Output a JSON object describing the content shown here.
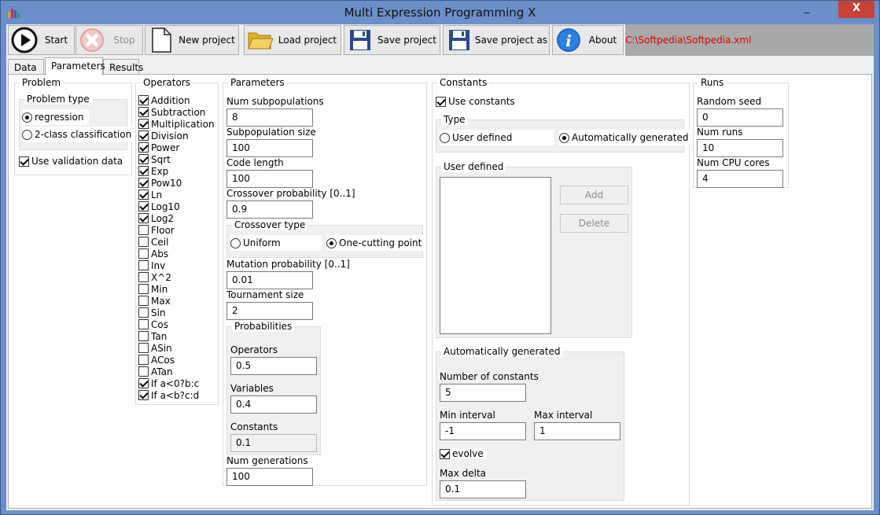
{
  "window": {
    "title": "Multi Expression Programming X",
    "minimize": "_",
    "close": "X"
  },
  "toolbar": {
    "start": "Start",
    "stop": "Stop",
    "new_project": "New project",
    "load_project": "Load project",
    "save_project": "Save project",
    "save_project_as": "Save project as",
    "about": "About",
    "path": "C:\\Softpedia\\Softpedia.xml"
  },
  "tabs": [
    "Data",
    "Parameters",
    "Results"
  ],
  "problem": {
    "title": "Problem",
    "type_title": "Problem type",
    "regression": "regression",
    "classification": "2-class classification",
    "use_validation": "Use validation data"
  },
  "operators": {
    "title": "Operators",
    "items": [
      {
        "label": "Addition",
        "checked": true
      },
      {
        "label": "Subtraction",
        "checked": true
      },
      {
        "label": "Multiplication",
        "checked": true
      },
      {
        "label": "Division",
        "checked": true
      },
      {
        "label": "Power",
        "checked": true
      },
      {
        "label": "Sqrt",
        "checked": true
      },
      {
        "label": "Exp",
        "checked": true
      },
      {
        "label": "Pow10",
        "checked": true
      },
      {
        "label": "Ln",
        "checked": true
      },
      {
        "label": "Log10",
        "checked": true
      },
      {
        "label": "Log2",
        "checked": true
      },
      {
        "label": "Floor",
        "checked": false
      },
      {
        "label": "Ceil",
        "checked": false
      },
      {
        "label": "Abs",
        "checked": false
      },
      {
        "label": "Inv",
        "checked": false
      },
      {
        "label": "X^2",
        "checked": false
      },
      {
        "label": "Min",
        "checked": false
      },
      {
        "label": "Max",
        "checked": false
      },
      {
        "label": "Sin",
        "checked": false
      },
      {
        "label": "Cos",
        "checked": false
      },
      {
        "label": "Tan",
        "checked": false
      },
      {
        "label": "ASin",
        "checked": false
      },
      {
        "label": "ACos",
        "checked": false
      },
      {
        "label": "ATan",
        "checked": false
      },
      {
        "label": "If a<0?b:c",
        "checked": true
      },
      {
        "label": "If a<b?c:d",
        "checked": true
      }
    ]
  },
  "parameters": {
    "title": "Parameters",
    "num_subpop_label": "Num subpopulations",
    "num_subpop": "8",
    "subpop_size_label": "Subpopulation size",
    "subpop_size": "100",
    "code_length_label": "Code length",
    "code_length": "100",
    "crossover_prob_label": "Crossover probability [0..1]",
    "crossover_prob": "0.9",
    "crossover_type_title": "Crossover type",
    "uniform": "Uniform",
    "one_cutting": "One-cutting point",
    "mutation_prob_label": "Mutation probability [0..1]",
    "mutation_prob": "0.01",
    "tournament_label": "Tournament size",
    "tournament": "2",
    "prob_title": "Probabilities",
    "operators_label": "Operators",
    "operators_val": "0.5",
    "variables_label": "Variables",
    "variables_val": "0.4",
    "constants_label": "Constants",
    "constants_val": "0.1",
    "num_gen_label": "Num generations",
    "num_gen": "100"
  },
  "constants": {
    "title": "Constants",
    "use_constants": "Use constants",
    "type_title": "Type",
    "user_defined": "User defined",
    "auto_generated": "Automatically generated",
    "user_defined_title": "User defined",
    "add": "Add",
    "delete": "Delete",
    "auto_title": "Automatically generated",
    "num_const_label": "Number of constants",
    "num_const": "5",
    "min_label": "Min interval",
    "min_val": "-1",
    "max_label": "Max interval",
    "max_val": "1",
    "evolve": "evolve",
    "max_delta_label": "Max delta",
    "max_delta": "0.1"
  },
  "runs": {
    "title": "Runs",
    "seed_label": "Random seed",
    "seed": "0",
    "num_runs_label": "Num runs",
    "num_runs": "10",
    "cpu_label": "Num CPU cores",
    "cpu": "4"
  }
}
